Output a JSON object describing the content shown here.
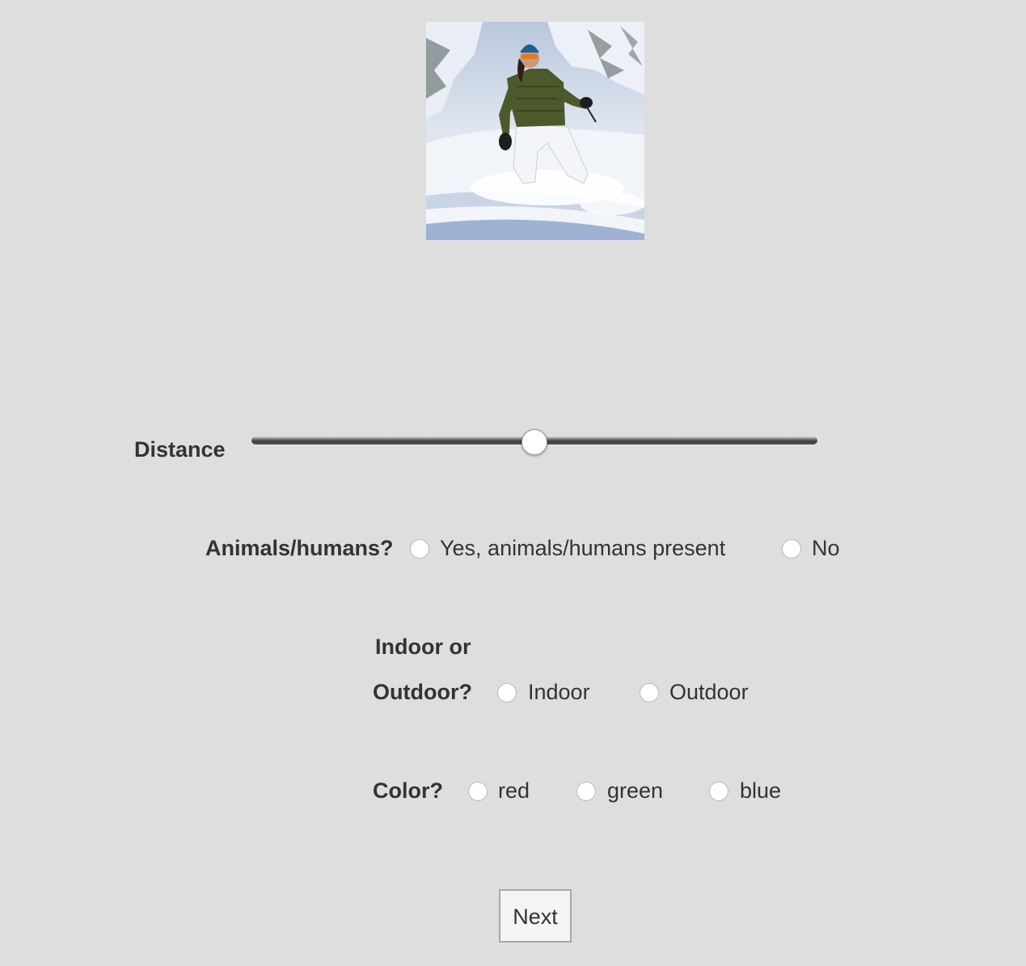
{
  "stimulus": {
    "description_icon": "snowboarder-photo-icon"
  },
  "distance": {
    "label": "Distance",
    "value_fraction": 0.5
  },
  "animals": {
    "label": "Animals/humans?",
    "options": [
      "Yes, animals/humans present",
      "No"
    ]
  },
  "indoor": {
    "label_line1": "Indoor or",
    "label_line2": "Outdoor?",
    "options": [
      "Indoor",
      "Outdoor"
    ]
  },
  "color": {
    "label": "Color?",
    "options": [
      "red",
      "green",
      "blue"
    ]
  },
  "next_button": {
    "label": "Next"
  },
  "colors": {
    "background": "#dedede",
    "text": "#333333"
  }
}
